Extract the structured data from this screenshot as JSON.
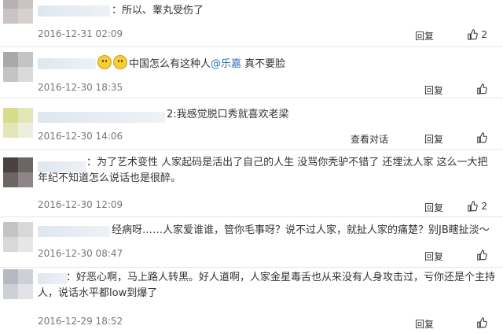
{
  "comments": [
    {
      "text": "：所以、睾丸受伤了",
      "date": "2016-12-31 02:09",
      "reply": "回复",
      "likes": "2"
    },
    {
      "text": "中国怎么有这种人",
      "mention": "@乐嘉",
      "text2": "真不要脸",
      "date": "2016-12-30 18:35",
      "reply": "回复"
    },
    {
      "text": "2:我感觉脱口秀就喜欢老梁",
      "date": "2016-12-30 14:06",
      "view_dialog": "查看对话",
      "reply": "回复"
    },
    {
      "text": "：为了艺术变性 人家起码是活出了自己的人生 没骂你秃驴不错了 还埋汰人家 这么一大把年纪不知道怎么说话也是很醉。",
      "date": "2016-12-30 12:09",
      "reply": "回复",
      "likes": "2"
    },
    {
      "text": "经病呀……人家爱谁谁，管你毛事呀？说不过人家，就扯人家的痛楚？别JB瞎扯淡～",
      "date": "2016-12-30 08:47",
      "reply": "回复"
    },
    {
      "text": "：好恶心啊，马上路人转黑。好人道啊，人家金星毒舌也从来没有人身攻击过，亏你还是个主持人，说话水平都low到爆了",
      "date": "2016-12-29 18:52",
      "reply": "回复"
    }
  ],
  "colors": {
    "link": "#2d6fb4",
    "date": "#777777",
    "separator": "#e6e6e6"
  }
}
